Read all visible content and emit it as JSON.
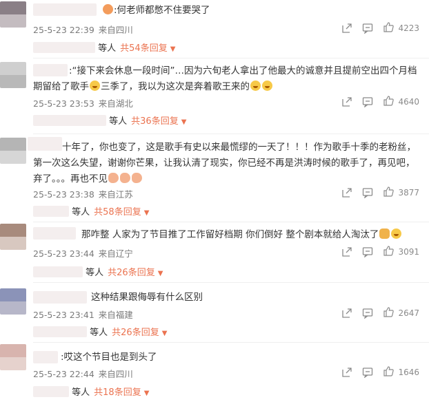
{
  "comments": [
    {
      "text": ":何老师都憋不住要哭了",
      "time": "25-5-23 22:39",
      "location": "来自四川",
      "likes": "4223",
      "reply_prefix": "等人",
      "reply_count": "共54条回复",
      "avatar_colors": [
        "#8a7f86",
        "#c4bcc0"
      ]
    },
    {
      "text": ":“接下来会休息一段时间”…因为六旬老人拿出了他最大的诚意并且提前空出四个月档期留给了歌手",
      "text2": "三季了，我以为这次是奔着歌王来的",
      "time": "25-5-23 23:53",
      "location": "来自湖北",
      "likes": "4640",
      "reply_prefix": "等人",
      "reply_count": "共36条回复",
      "avatar_colors": [
        "#cfcfcf",
        "#b9b9b9"
      ]
    },
    {
      "text": "十年了，你也变了，这是歌手有史以来最慌缪的一天了！！！作为歌手十季的老粉丝，第一次这么失望，谢谢你芒果，让我认清了现实，你已经不再是洪涛时候的歌手了，再见吧，弃了。。。再也不见",
      "time": "25-5-23 23:38",
      "location": "来自江苏",
      "likes": "3877",
      "reply_prefix": "等人",
      "reply_count": "共58条回复",
      "avatar_colors": [
        "#b5b5b5",
        "#d6d6d6"
      ]
    },
    {
      "text": "那咋整 人家为了节目推了工作留好档期 你们倒好 整个剧本就给人淘汰了",
      "time": "25-5-23 23:44",
      "location": "来自辽宁",
      "likes": "3091",
      "reply_prefix": "等人",
      "reply_count": "共26条回复",
      "avatar_colors": [
        "#a88b7d",
        "#d8c8c0"
      ]
    },
    {
      "text": "这种结果跟侮辱有什么区别",
      "time": "25-5-23 23:41",
      "location": "来自福建",
      "likes": "2647",
      "reply_prefix": "等人",
      "reply_count": "共26条回复",
      "avatar_colors": [
        "#8b93b8",
        "#b7b7c9"
      ]
    },
    {
      "text": ":哎这个节目也是到头了",
      "time": "25-5-23 22:44",
      "location": "来自四川",
      "likes": "1646",
      "reply_prefix": "等人",
      "reply_count": "共18条回复",
      "avatar_colors": [
        "#d8b4ae",
        "#e6d2cd"
      ]
    }
  ],
  "icons": {
    "share": "share-icon",
    "comment": "comment-icon",
    "like": "thumbs-up-icon",
    "caret": "caret-down-icon"
  },
  "accent_color": "#eb7350"
}
